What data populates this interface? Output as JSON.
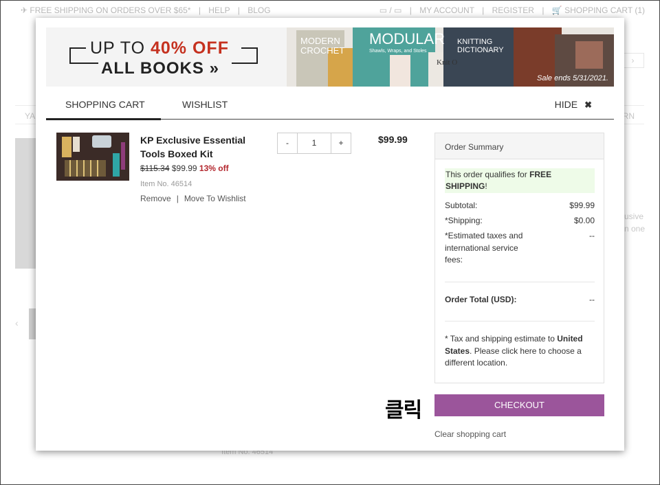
{
  "background": {
    "topbar_left": "FREE SHIPPING ON ORDERS OVER $65*",
    "topbar_help": "HELP",
    "topbar_blog": "BLOG",
    "topbar_account": "MY ACCOUNT",
    "topbar_register": "REGISTER",
    "topbar_cart": "SHOPPING CART (1)",
    "nav_left": "YA",
    "nav_right": "RN",
    "side_text_1": "usive",
    "side_text_2": "n one",
    "item_text": "Item No. 46514"
  },
  "banner": {
    "line1_prefix": "UP TO",
    "line1_highlight": "40% OFF",
    "line2": "ALL BOOKS »",
    "sale_note": "Sale ends 5/31/2021."
  },
  "tabs": {
    "cart": "SHOPPING CART",
    "wishlist": "WISHLIST",
    "hide": "HIDE"
  },
  "product": {
    "name": "KP Exclusive Essential Tools Boxed Kit",
    "old_price": "$115.34",
    "price": "$99.99",
    "discount": "13% off",
    "item_no": "Item No. 46514",
    "remove": "Remove",
    "move_to_wishlist": "Move To Wishlist",
    "qty_minus": "-",
    "qty_value": "1",
    "qty_plus": "+",
    "line_price": "$99.99"
  },
  "summary": {
    "title": "Order Summary",
    "free_ship_prefix": "This order qualifies for",
    "free_ship_bold": "FREE SHIPPING",
    "free_ship_suffix": "!",
    "subtotal_label": "Subtotal:",
    "subtotal_value": "$99.99",
    "shipping_label": "*Shipping:",
    "shipping_value": "$0.00",
    "tax_label": "*Estimated taxes and international service fees:",
    "tax_value": "--",
    "total_label": "Order Total (USD):",
    "total_value": "--",
    "note_prefix": "* Tax and shipping estimate to",
    "note_country": "United States",
    "note_mid": ". Please",
    "note_link": "click here",
    "note_suffix": "to choose a different location."
  },
  "annotation": "클릭",
  "checkout": "CHECKOUT",
  "clear_cart": "Clear shopping cart",
  "colors": {
    "checkout": "#9b559b",
    "discount": "#b3262d",
    "banner_red": "#c5311f",
    "free_ship_bg": "#eefbe8"
  }
}
